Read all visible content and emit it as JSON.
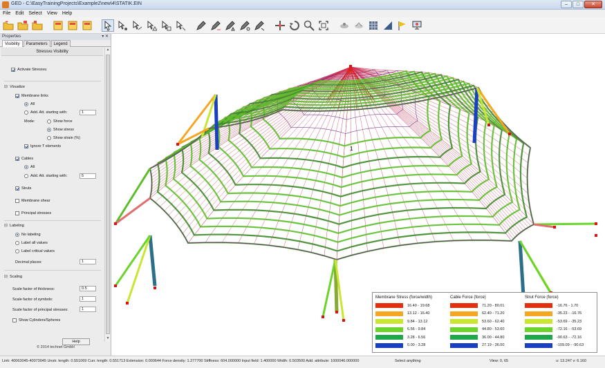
{
  "window": {
    "title": "GED - C:\\EasyTrainingProjects\\Example2\\new\\4\\STATIK.EIN",
    "buttons": [
      "–",
      "□",
      "✕"
    ]
  },
  "menu": [
    "File",
    "Edit",
    "Select",
    "View",
    "Help"
  ],
  "toolbar": {
    "icons": [
      "open-folder-icon",
      "open-folder-icon",
      "open-folder-icon",
      "dataset-icon",
      "dataset-icon",
      "dataset-icon",
      "select-arrow-icon",
      "select-node-icon",
      "select-link-icon",
      "select-element-icon",
      "select-area-icon",
      "select-misc-icon",
      "pencil-icon",
      "pencil-icon",
      "pencil-icon",
      "pencil-icon",
      "pencil-icon",
      "pan-icon",
      "rotate-icon",
      "zoom-icon",
      "zoom-extents-icon",
      "view-front-icon",
      "view-side-icon",
      "table-icon",
      "triangle-icon",
      "flag-icon",
      "computer-icon"
    ]
  },
  "panel": {
    "header": "Properties",
    "header_buttons": "▾ ✕",
    "tabs": [
      "Visibility",
      "Parameters",
      "Legend"
    ],
    "section_title": "Stressvu Visibility",
    "activate": "Activate Stressvu",
    "visualize": {
      "title": "Visualize",
      "membrane_links": "Membrane links",
      "all": "All",
      "add_att": "Add. Att. starting with:",
      "add_att_value": "1",
      "mode_label": "Mode:",
      "show_force": "Show force",
      "show_stress": "Show stress",
      "show_strain": "Show strain (%)",
      "ignore_t": "Ignore T elements",
      "cables": "Cables",
      "cables_all": "All",
      "cables_add_att": "Add. Att. starting with:",
      "cables_add_att_value": "5",
      "struts": "Struts",
      "membrane_shear": "Membrane shear",
      "principal_stresses": "Principal stresses"
    },
    "labeling": {
      "title": "Labeling",
      "no_labeling": "No labeling",
      "label_all": "Label all values",
      "label_critical": "Label critical values",
      "decimal_places": "Decimal places:",
      "decimal_value": "1"
    },
    "scaling": {
      "title": "Scaling",
      "thickness": "Scale factor of thickness:",
      "thickness_value": "0.5",
      "symbols": "Scale factor of symbols:",
      "symbols_value": "1",
      "principal": "Scale factor of principal stresses:",
      "principal_value": "1",
      "show_cyl": "Show Cylinders/Spheres"
    },
    "help_button": "Help",
    "copyright": "© 2014 technet GmbH"
  },
  "legend": {
    "membrane": {
      "title": "Membrane Stress (force/width)",
      "rows": [
        "16.40 - 19.68",
        "13.12 - 16.40",
        "9.84 - 13.12",
        "6.56 - 9.84",
        "3.28 - 6.56",
        "0.00 - 3.28"
      ]
    },
    "cable": {
      "title": "Cable Force (force)",
      "rows": [
        "71.20 - 80.01",
        "62.40 - 71.20",
        "53.60 - 62.40",
        "44.80 - 53.60",
        "36.00 - 44.80",
        "27.19 - 36.00"
      ]
    },
    "strut": {
      "title": "Strut Force (force)",
      "rows": [
        "-16.76 - 1.70",
        "-35.23 - -16.76",
        "-53.69 - -35.23",
        "-72.16 - -53.69",
        "-90.63 - -72.16",
        "-109.09 - -90.63"
      ]
    },
    "colors": [
      "#e03010",
      "#f5a623",
      "#c8e632",
      "#6ad42a",
      "#1fa84a",
      "#1a3fc0"
    ]
  },
  "viewport": {
    "cursor_label": "1"
  },
  "status": {
    "main": "Link: 40063045-40073045 Unstr. length: 0.551069 Curr. length: 0.551713 Extension: 0.000644 Force density: 1.277700 Stiffness: 604.000000 Input field: 1.400000 Width: 0.503500 Add. attribute: 1000046.000000",
    "select": "Select anything",
    "view": "View: 0, 65",
    "uv": "u: 13.247 v: 6.160"
  }
}
